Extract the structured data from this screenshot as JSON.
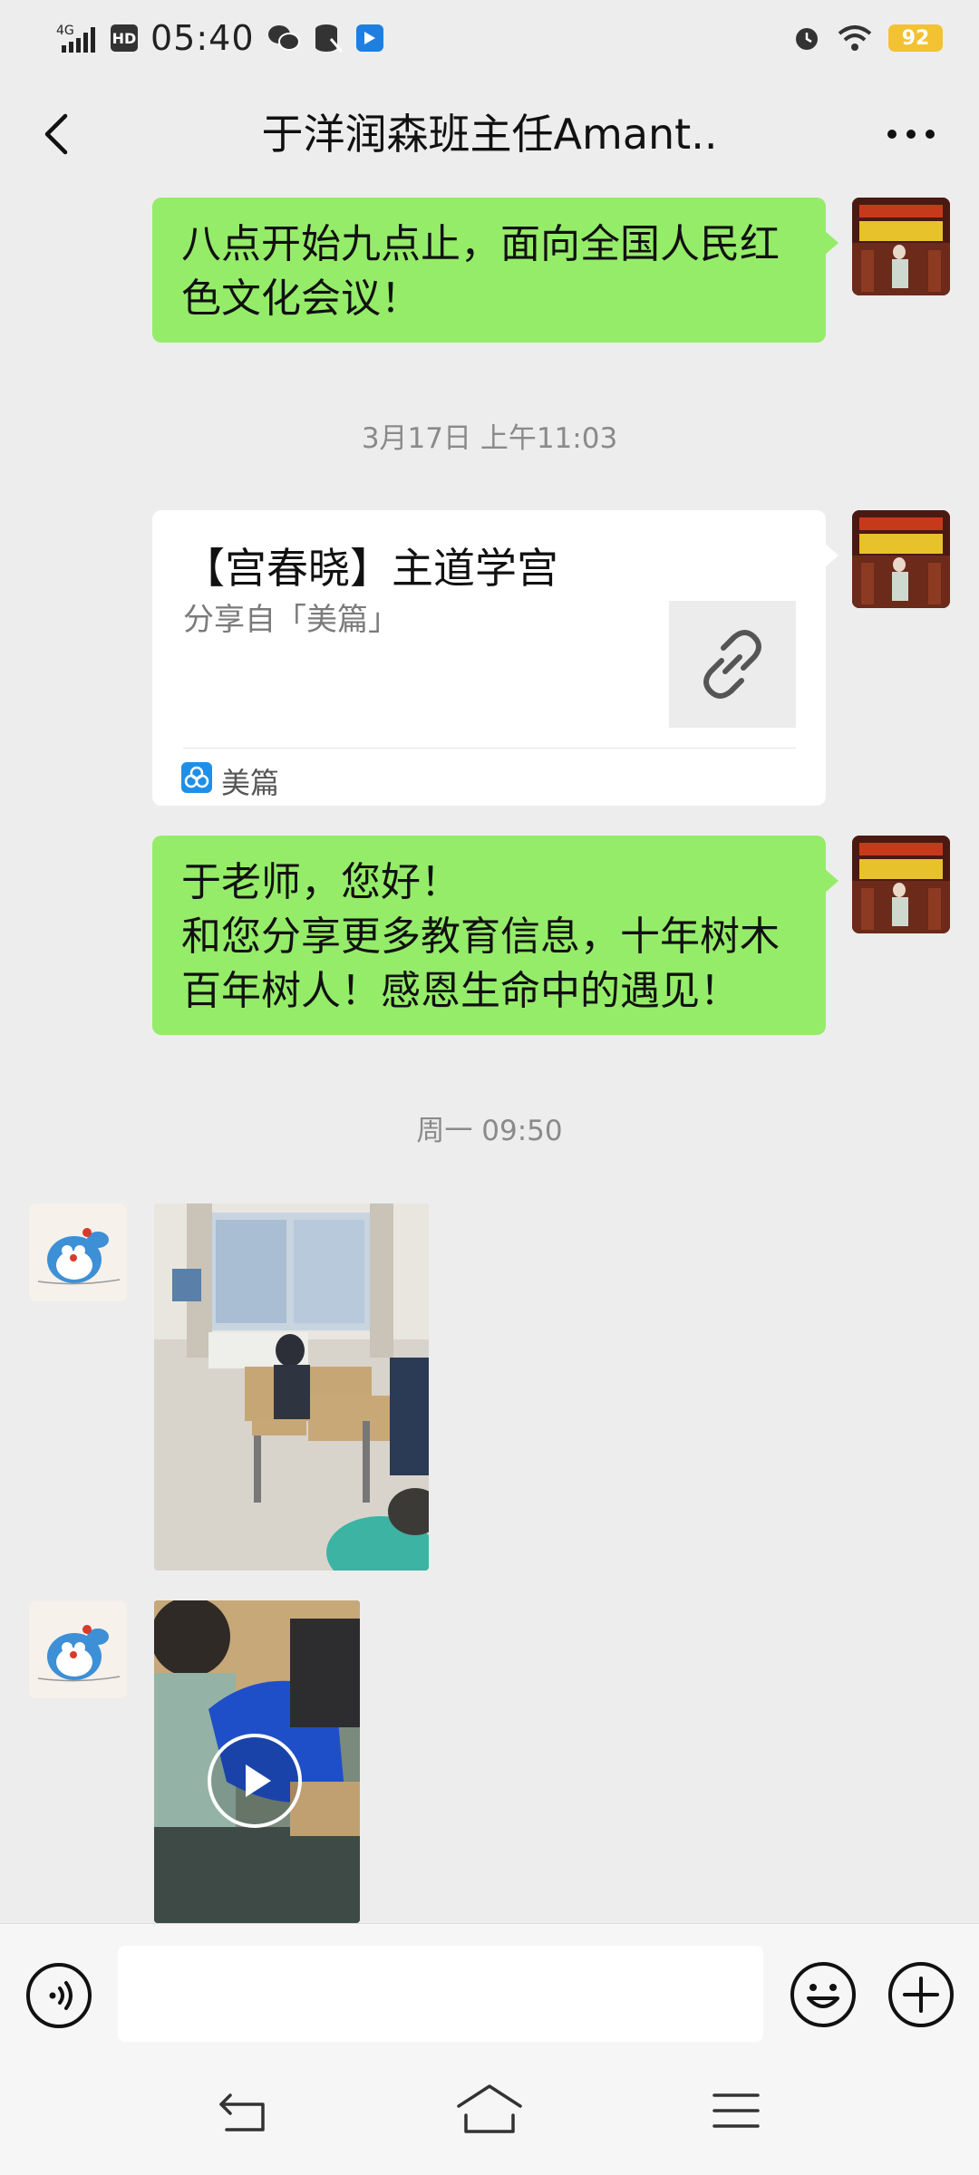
{
  "status_bar": {
    "network": "4G",
    "hd": "HD",
    "time": "05:40",
    "battery": "92"
  },
  "header": {
    "title": "于洋润森班主任Amant..",
    "back_icon": "chevron-left-icon",
    "more_icon": "more-dots-icon"
  },
  "messages": [
    {
      "type": "text",
      "side": "right",
      "text": "八点开始九点止，面向全国人民红色文化会议！"
    },
    {
      "type": "timestamp",
      "text": "3月17日 上午11:03"
    },
    {
      "type": "link-card",
      "side": "right",
      "title": "【宫春晓】主道学宫",
      "subtitle": "分享自「美篇」",
      "source": "美篇",
      "thumb_icon": "link-icon"
    },
    {
      "type": "text",
      "side": "right",
      "lines": [
        "于老师，您好！",
        "和您分享更多教育信息，十年树木",
        "百年树人！感恩生命中的遇见！"
      ]
    },
    {
      "type": "timestamp",
      "text": "周一 09:50"
    },
    {
      "type": "image",
      "side": "left"
    },
    {
      "type": "video",
      "side": "left"
    }
  ],
  "input_bar": {
    "value": "",
    "placeholder": "",
    "voice_icon": "voice-icon",
    "emoji_icon": "emoji-icon",
    "plus_icon": "plus-icon"
  },
  "nav_bar": {
    "back_icon": "nav-back-icon",
    "home_icon": "nav-home-icon",
    "menu_icon": "nav-menu-icon"
  },
  "colors": {
    "chat_bg": "#ededed",
    "bubble_green": "#95ec69",
    "battery": "#f2c233",
    "timestamp": "#8a8a8a"
  }
}
